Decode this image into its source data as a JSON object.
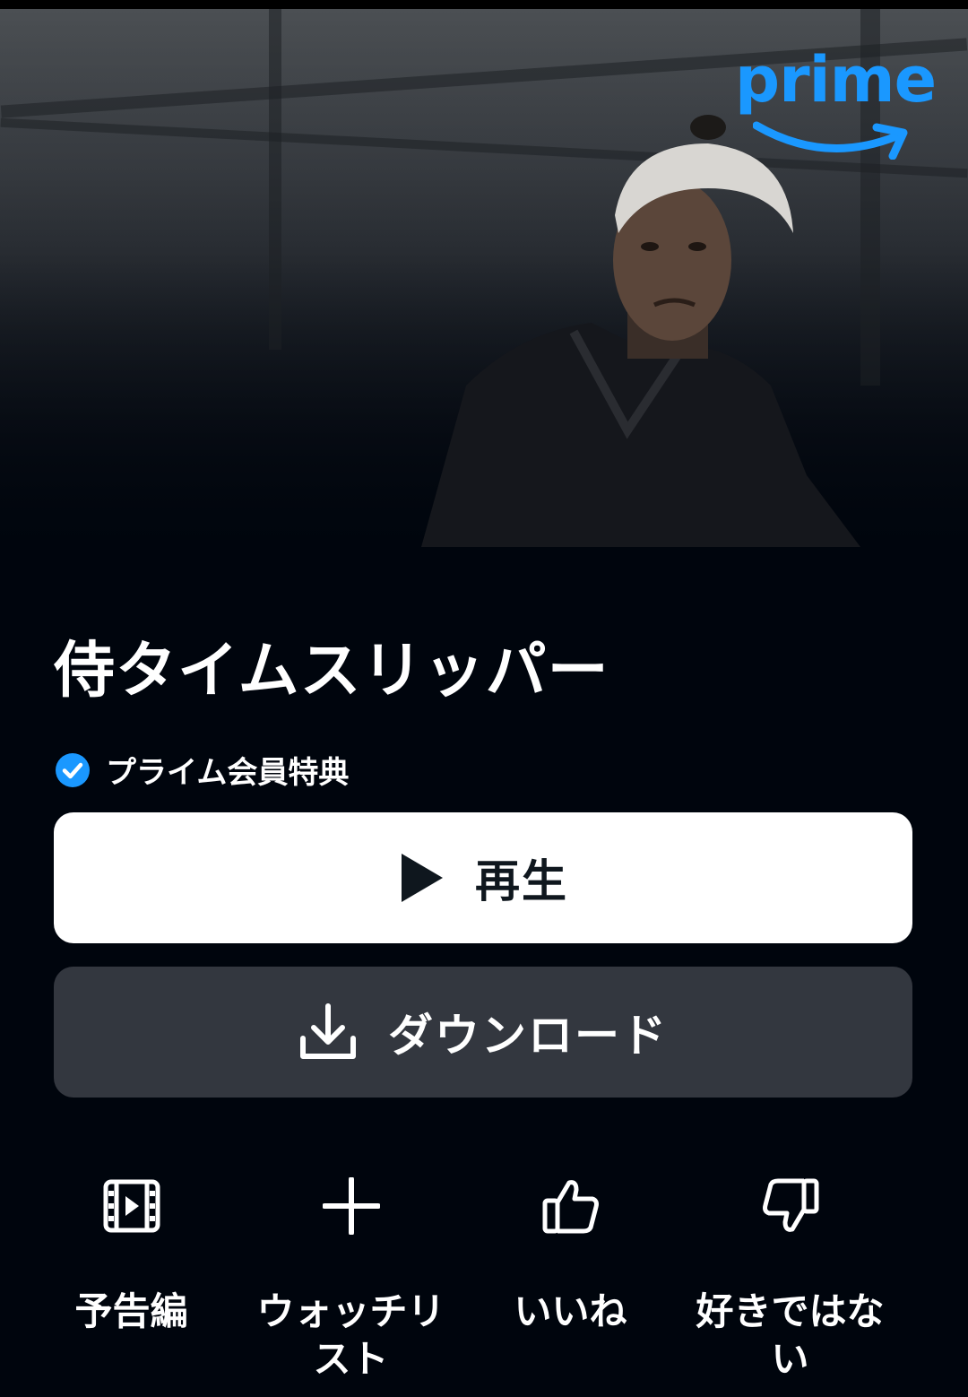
{
  "hero": {
    "brand_logo": "prime",
    "brand_color": "#1a98ff"
  },
  "title": "侍タイムスリッパー",
  "badge": {
    "icon": "check-circle-icon",
    "label": "プライム会員特典",
    "color": "#1a98ff"
  },
  "buttons": {
    "play": {
      "icon": "play-icon",
      "label": "再生"
    },
    "download": {
      "icon": "download-icon",
      "label": "ダウンロード"
    }
  },
  "actions": [
    {
      "icon": "trailer-icon",
      "label": "予告編"
    },
    {
      "icon": "plus-icon",
      "label": "ウォッチリスト"
    },
    {
      "icon": "thumbs-up-icon",
      "label": "いいね"
    },
    {
      "icon": "thumbs-down-icon",
      "label": "好きではない"
    }
  ],
  "colors": {
    "background": "#00050d",
    "play_button": "#ffffff",
    "download_button": "#33373f"
  }
}
